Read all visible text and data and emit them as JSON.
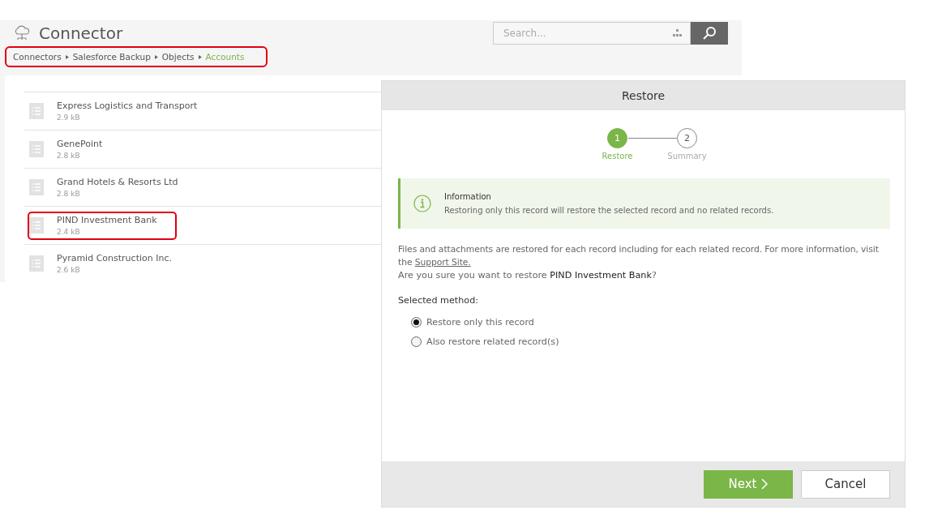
{
  "app": {
    "title": "Connector",
    "search": {
      "placeholder": "Search..."
    }
  },
  "breadcrumb": {
    "highlighted": true,
    "items": [
      {
        "label": "Connectors",
        "current": false
      },
      {
        "label": "Salesforce Backup",
        "current": false
      },
      {
        "label": "Objects",
        "current": false
      },
      {
        "label": "Accounts",
        "current": true
      }
    ]
  },
  "records": [
    {
      "name": "Express Logistics and Transport",
      "size": "2.9 kB",
      "highlighted": false
    },
    {
      "name": "GenePoint",
      "size": "2.8 kB",
      "highlighted": false
    },
    {
      "name": "Grand Hotels & Resorts Ltd",
      "size": "2.8 kB",
      "highlighted": false
    },
    {
      "name": "PIND Investment Bank",
      "size": "2.4 kB",
      "highlighted": true
    },
    {
      "name": "Pyramid Construction Inc.",
      "size": "2.6 kB",
      "highlighted": false
    }
  ],
  "dialog": {
    "title": "Restore",
    "steps": [
      {
        "number": "1",
        "label": "Restore",
        "selected": true
      },
      {
        "number": "2",
        "label": "Summary",
        "selected": false
      }
    ],
    "info": {
      "title": "Information",
      "text": "Restoring only this record will restore the selected record and no related records."
    },
    "description": "Files and attachments are restored for each record including for each related record. For more information, visit the",
    "link": "Support Site.",
    "question": "Are you sure you want to restore **PIND Investment Bank**?",
    "method_label": "Selected method:",
    "methods": [
      {
        "label": "Restore only this record",
        "selected": true
      },
      {
        "label": "Also restore related record(s)",
        "selected": false
      }
    ],
    "buttons": [
      {
        "label": "Next",
        "kind": "primary"
      },
      {
        "label": "Cancel",
        "kind": "secondary"
      }
    ]
  }
}
